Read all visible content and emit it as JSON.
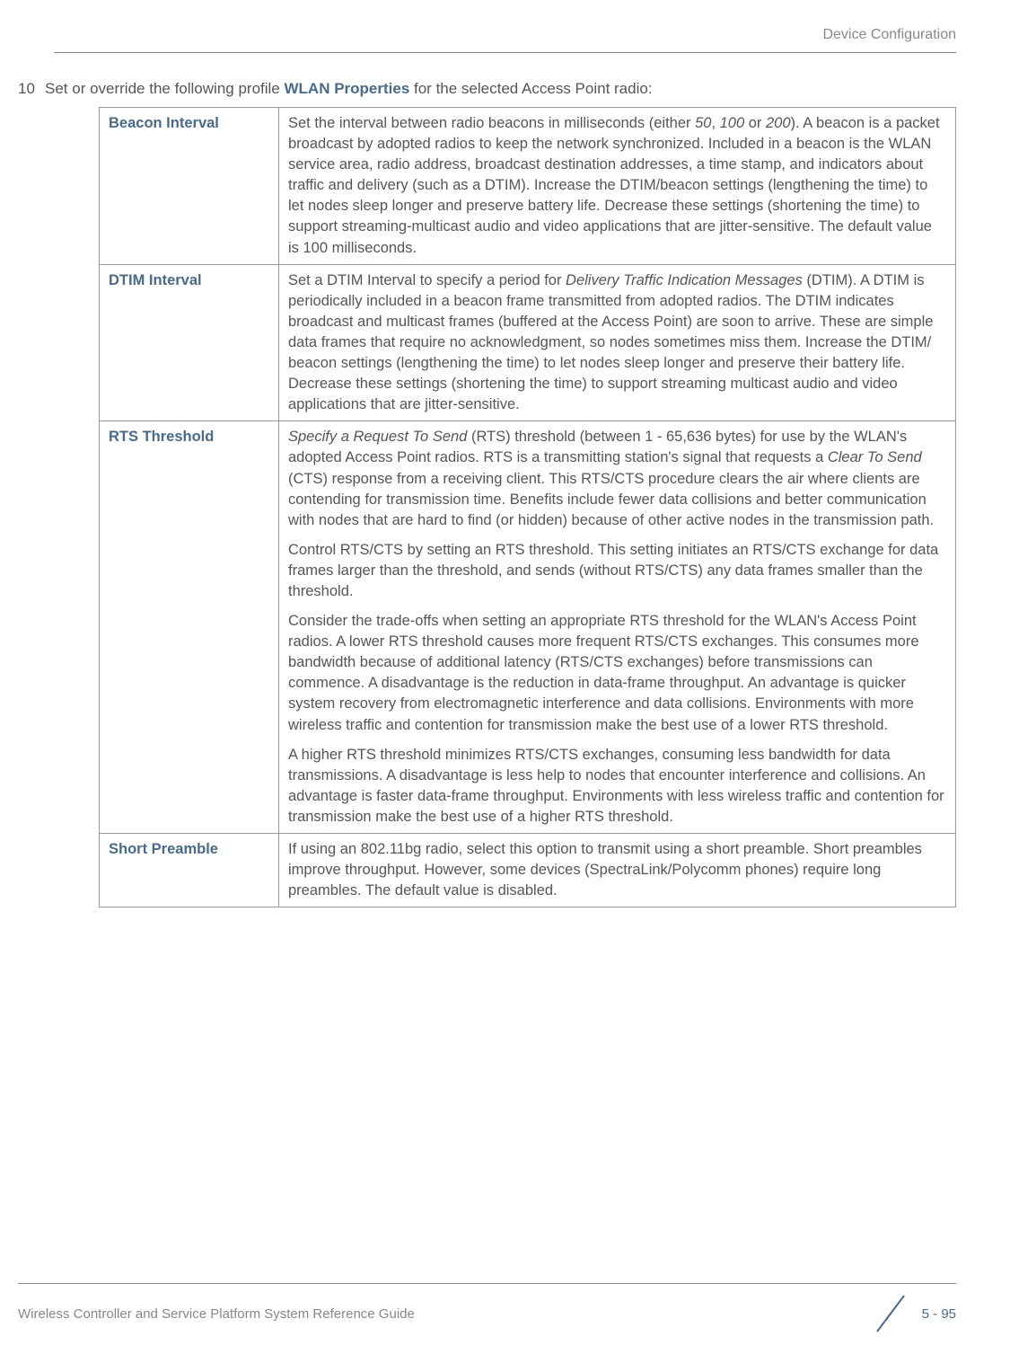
{
  "header": {
    "section": "Device Configuration"
  },
  "instruction": {
    "number": "10",
    "prefix": "Set or override the following profile ",
    "boldText": "WLAN Properties",
    "suffix": " for the selected Access Point radio:"
  },
  "table": {
    "rows": [
      {
        "label": "Beacon Interval",
        "paragraphs": [
          {
            "segments": [
              {
                "text": "Set the interval between radio beacons in milliseconds (either "
              },
              {
                "text": "50",
                "italic": true
              },
              {
                "text": ", "
              },
              {
                "text": "100",
                "italic": true
              },
              {
                "text": " or "
              },
              {
                "text": "200",
                "italic": true
              },
              {
                "text": "). A beacon is a packet broadcast by adopted radios to keep the network synchronized. Included in a beacon is the WLAN service area, radio address, broadcast destination addresses, a time stamp, and indicators about traffic and delivery (such as a DTIM). Increase the DTIM/beacon settings (lengthening the time) to let nodes sleep longer and preserve battery life. Decrease these settings (shortening the time) to support streaming-multicast audio and video applications that are jitter-sensitive. The default value is 100 milliseconds."
              }
            ]
          }
        ]
      },
      {
        "label": "DTIM Interval",
        "paragraphs": [
          {
            "segments": [
              {
                "text": "Set a DTIM Interval to specify a period for "
              },
              {
                "text": "Delivery Traffic Indication Messages",
                "italic": true
              },
              {
                "text": " (DTIM). A DTIM is periodically included in a beacon frame transmitted from adopted radios. The DTIM indicates broadcast and multicast frames (buffered at the Access Point) are soon to arrive. These are simple data frames that require no acknowledgment, so nodes sometimes miss them. Increase the DTIM/ beacon settings (lengthening the time) to let nodes sleep longer and preserve their battery life. Decrease these settings (shortening the time) to support streaming multicast audio and video applications that are jitter-sensitive."
              }
            ]
          }
        ]
      },
      {
        "label": "RTS Threshold",
        "paragraphs": [
          {
            "segments": [
              {
                "text": "Specify a Request To Send",
                "italic": true
              },
              {
                "text": " (RTS) threshold (between 1 - 65,636 bytes) for use by the WLAN's adopted Access Point radios. RTS is a transmitting station's signal that requests a "
              },
              {
                "text": "Clear To Send",
                "italic": true
              },
              {
                "text": " (CTS) response from a receiving client. This RTS/CTS procedure clears the air where clients are contending for transmission time. Benefits include fewer data collisions and better communication with nodes that are hard to find (or hidden) because of other active nodes in the transmission path."
              }
            ]
          },
          {
            "segments": [
              {
                "text": "Control RTS/CTS by setting an RTS threshold. This setting initiates an RTS/CTS exchange for data frames larger than the threshold, and sends (without RTS/CTS) any data frames smaller than the threshold."
              }
            ]
          },
          {
            "segments": [
              {
                "text": "Consider the trade-offs when setting an appropriate RTS threshold for the WLAN's Access Point radios. A lower RTS threshold causes more frequent RTS/CTS exchanges. This consumes more bandwidth because of additional latency (RTS/CTS exchanges) before transmissions can commence. A disadvantage is the reduction in data-frame throughput. An advantage is quicker system recovery from electromagnetic interference and data collisions. Environments with more wireless traffic and contention for transmission make the best use of a lower RTS threshold."
              }
            ]
          },
          {
            "segments": [
              {
                "text": "A higher RTS threshold minimizes RTS/CTS exchanges, consuming less bandwidth for data transmissions. A disadvantage is less help to nodes that encounter interference and collisions. An advantage is faster data-frame throughput. Environments with less wireless traffic and contention for transmission make the best use of a higher RTS threshold."
              }
            ]
          }
        ]
      },
      {
        "label": "Short Preamble",
        "paragraphs": [
          {
            "segments": [
              {
                "text": "If using an 802.11bg radio, select this option to transmit using a short preamble. Short preambles improve throughput. However, some devices (SpectraLink/Polycomm phones) require long preambles. The default value is disabled."
              }
            ]
          }
        ]
      }
    ]
  },
  "footer": {
    "text": "Wireless Controller and Service Platform System Reference Guide",
    "pageNumber": "5 - 95"
  }
}
